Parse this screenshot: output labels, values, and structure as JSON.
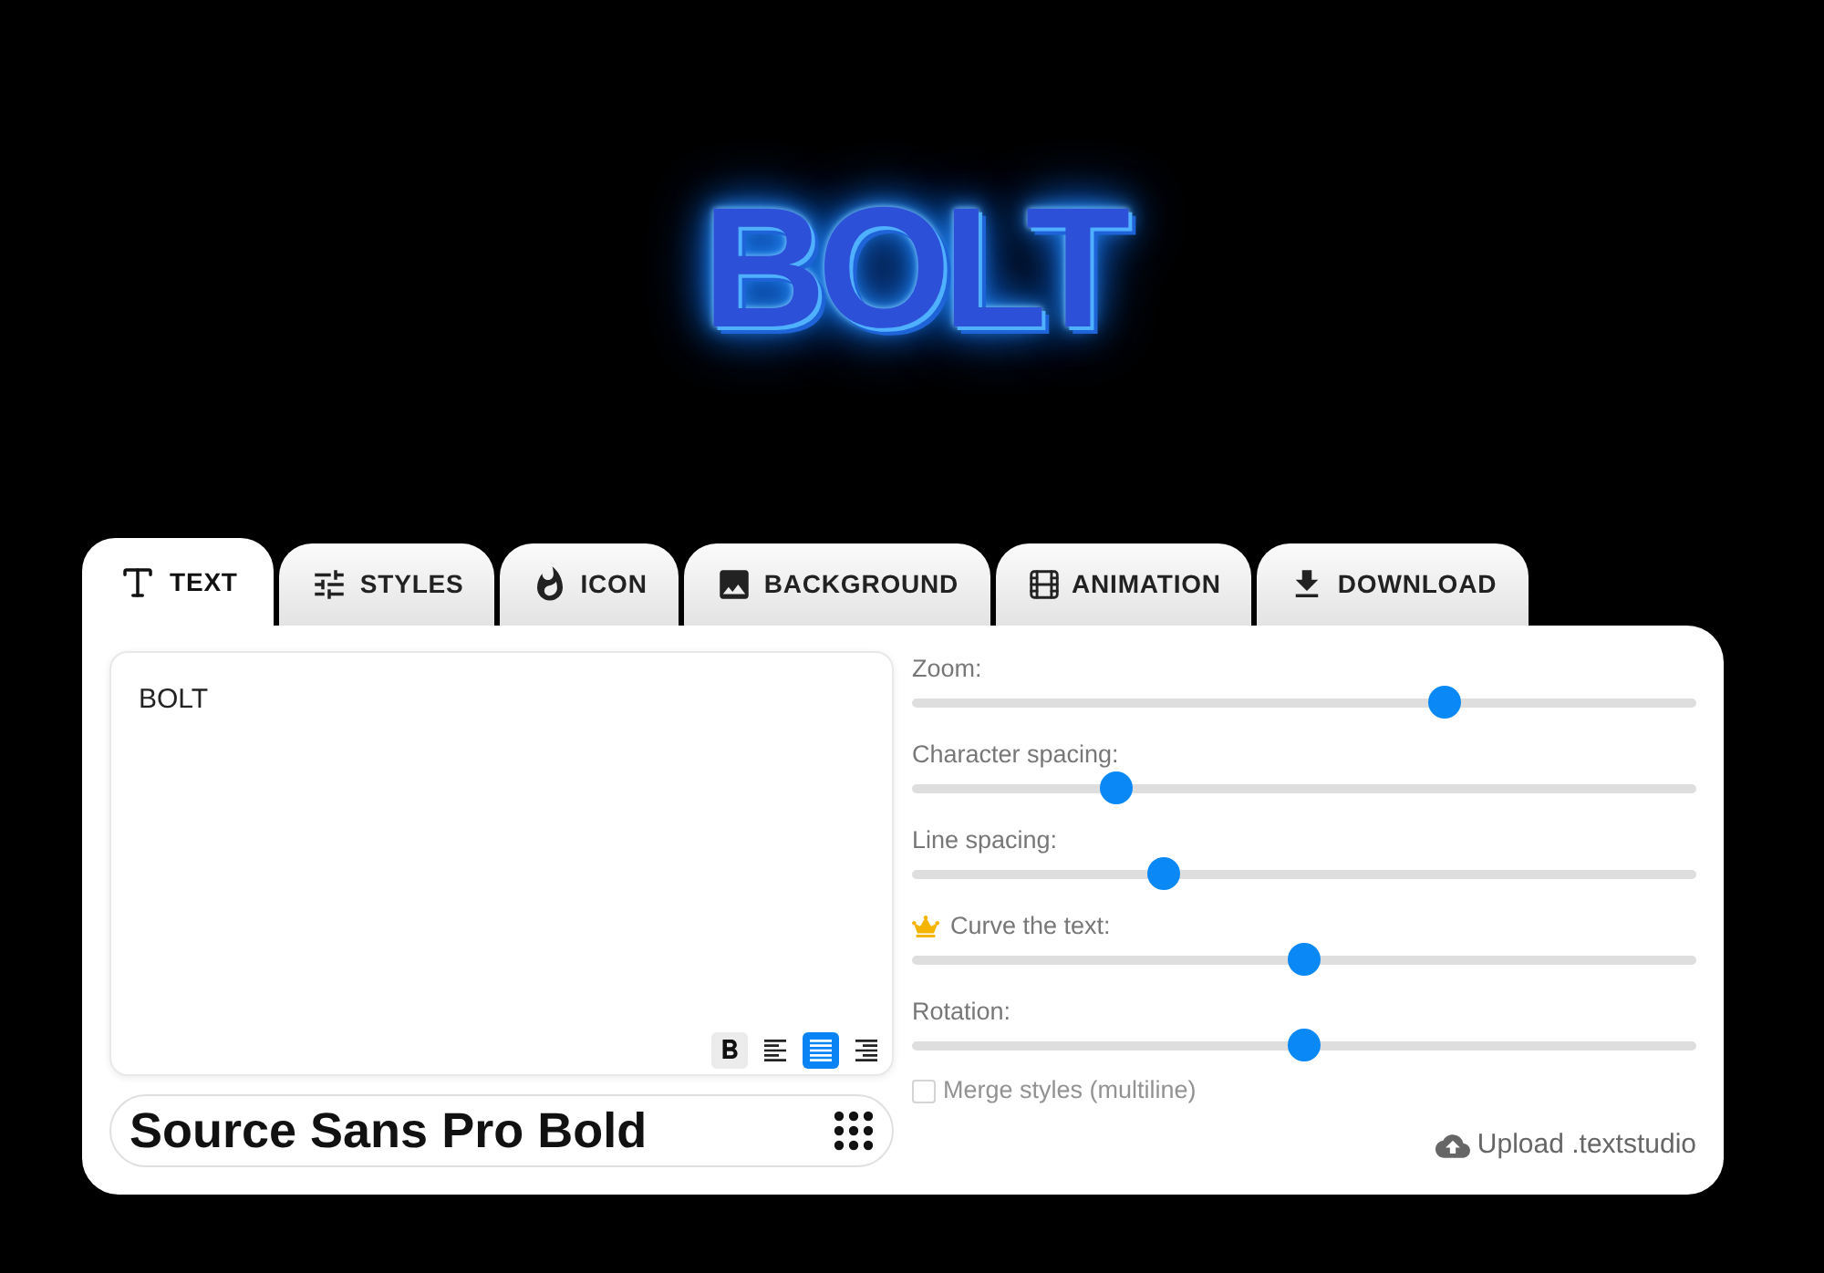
{
  "preview": {
    "text": "BOLT"
  },
  "tabs": [
    {
      "label": "TEXT",
      "selected": true
    },
    {
      "label": "STYLES",
      "selected": false
    },
    {
      "label": "ICON",
      "selected": false
    },
    {
      "label": "BACKGROUND",
      "selected": false
    },
    {
      "label": "ANIMATION",
      "selected": false
    },
    {
      "label": "DOWNLOAD",
      "selected": false
    }
  ],
  "text_editor": {
    "value": "BOLT",
    "bold": {
      "on": true
    },
    "alignments": [
      {
        "kind": "left",
        "selected": false
      },
      {
        "kind": "justify",
        "selected": true
      },
      {
        "kind": "right",
        "selected": false
      }
    ]
  },
  "font_picker": {
    "value": "Source Sans Pro Bold"
  },
  "sliders": [
    {
      "label": "Zoom:",
      "level": 0.68,
      "premium": false
    },
    {
      "label": "Character spacing:",
      "level": 0.26,
      "premium": false
    },
    {
      "label": "Line spacing:",
      "level": 0.32,
      "premium": false
    },
    {
      "label": "Curve the text:",
      "level": 0.5,
      "premium": true
    },
    {
      "label": "Rotation:",
      "level": 0.5,
      "premium": false
    }
  ],
  "merge_checkbox": {
    "label": "Merge styles (multiline)",
    "checked": false,
    "disabled": true
  },
  "upload_link": {
    "label": "Upload .textstudio"
  }
}
